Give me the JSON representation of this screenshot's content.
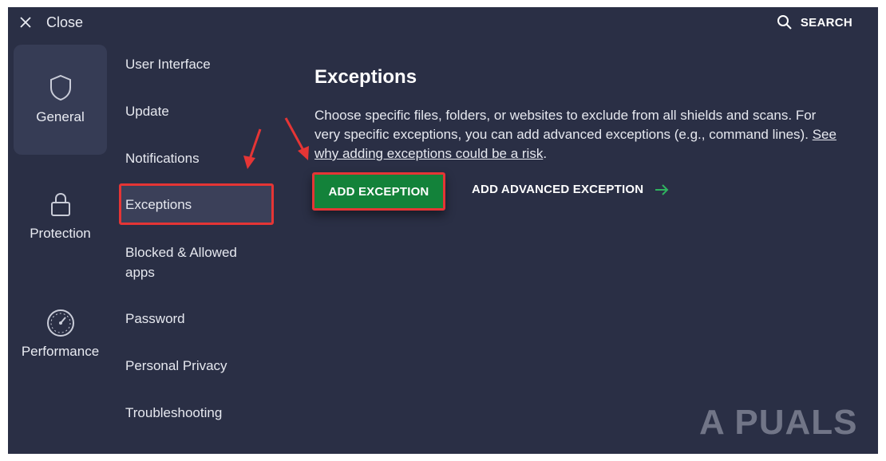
{
  "topbar": {
    "close_label": "Close",
    "search_label": "SEARCH"
  },
  "nav": {
    "categories": [
      {
        "label": "General",
        "icon": "shield-icon",
        "active": true
      },
      {
        "label": "Protection",
        "icon": "lock-icon",
        "active": false
      },
      {
        "label": "Performance",
        "icon": "speedometer-icon",
        "active": false
      }
    ]
  },
  "submenu": {
    "items": [
      {
        "label": "User Interface"
      },
      {
        "label": "Update"
      },
      {
        "label": "Notifications"
      },
      {
        "label": "Exceptions",
        "selected": true
      },
      {
        "label": "Blocked & Allowed apps"
      },
      {
        "label": "Password"
      },
      {
        "label": "Personal Privacy"
      },
      {
        "label": "Troubleshooting"
      }
    ]
  },
  "main": {
    "title": "Exceptions",
    "description": "Choose specific files, folders, or websites to exclude from all shields and scans. For very specific exceptions, you can add advanced exceptions (e.g., command lines).",
    "risk_link": "See why adding exceptions could be a risk",
    "risk_suffix": ".",
    "add_exception_label": "ADD EXCEPTION",
    "add_advanced_label": "ADD ADVANCED EXCEPTION"
  },
  "watermark": {
    "text": "A PUALS"
  },
  "colors": {
    "background": "#2a2f45",
    "accent_green": "#13823a",
    "highlight_red": "#e53535",
    "arrow_green": "#2fb35f"
  }
}
